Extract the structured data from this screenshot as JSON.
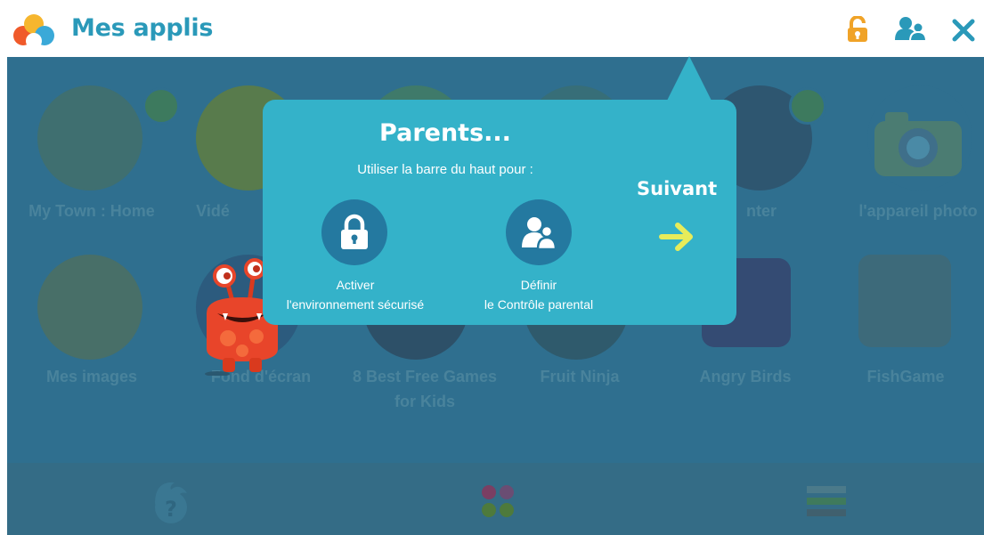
{
  "header": {
    "title": "Mes applis",
    "icons": [
      "app-logo-icon",
      "unlock-icon",
      "parental-users-icon",
      "close-icon"
    ],
    "accent_color": "#2a99b9"
  },
  "apps": [
    {
      "label": "My Town : Home",
      "download": true
    },
    {
      "label": "Vidé",
      "download": false
    },
    {
      "label": "",
      "download": false
    },
    {
      "label": "",
      "download": false
    },
    {
      "label": "nter",
      "download": true
    },
    {
      "label": "l'appareil photo",
      "download": false
    },
    {
      "label": "Mes images",
      "download": false
    },
    {
      "label": "Fond d'écran",
      "download": false
    },
    {
      "label": "8 Best Free Games",
      "label2": "for Kids",
      "download": false
    },
    {
      "label": "Fruit Ninja",
      "download": false
    },
    {
      "label": "Angry Birds",
      "download": false
    },
    {
      "label": "FishGame",
      "download": false
    }
  ],
  "popup": {
    "title": "Parents...",
    "subtitle": "Utiliser la barre du haut pour :",
    "feature_1_line1": "Activer",
    "feature_1_line2": "l'environnement sécurisé",
    "feature_2_line1": "Définir",
    "feature_2_line2": "le Contrôle parental",
    "next_label": "Suivant",
    "color": "#34b2c9"
  },
  "bottom_nav": [
    "help-icon",
    "apps-grid-icon",
    "menu-icon"
  ]
}
